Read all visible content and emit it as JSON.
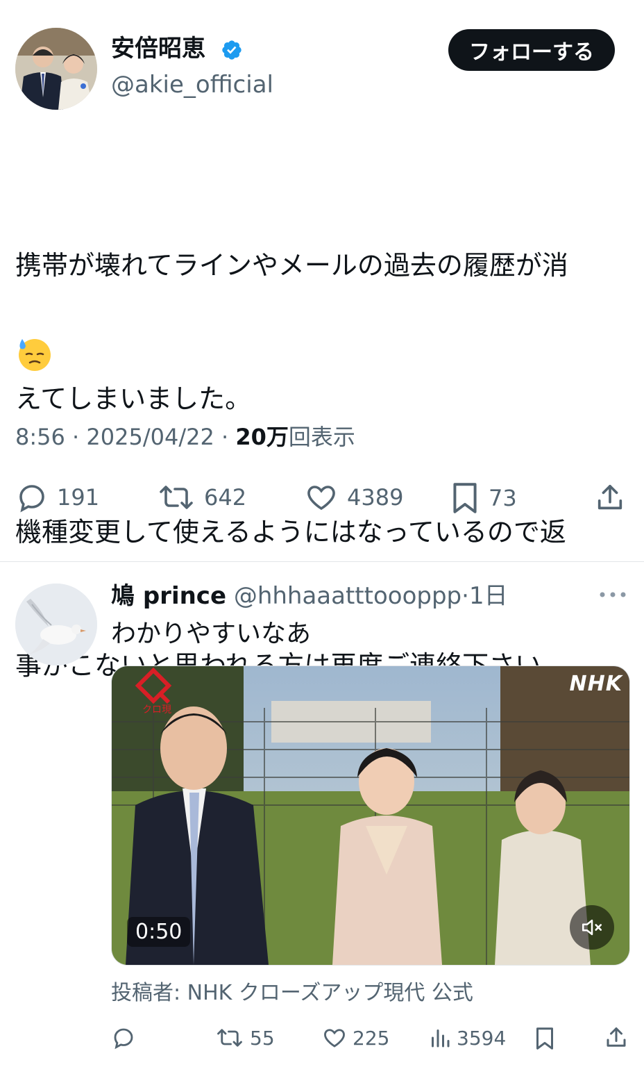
{
  "tweet": {
    "author_name": "安倍昭恵",
    "handle": "@akie_official",
    "follow_label": "フォローする",
    "text_lines": [
      "携帯が壊れてラインやメールの過去の履歴が消",
      "えてしまいました。",
      "機種変更して使えるようにはなっているので返",
      "事がこないと思われる方は再度ご連絡下さい"
    ],
    "emoji": "downcast-face-with-sweat",
    "time": "8:56",
    "date": "2025/04/22",
    "views_count": "20万",
    "views_label": "回表示",
    "separator": " · ",
    "stats": {
      "replies": "191",
      "retweets": "642",
      "likes": "4389",
      "bookmarks": "73"
    }
  },
  "reply": {
    "author_name": "鳩 prince",
    "handle": "@hhhaaatttoooppp",
    "time": "1日",
    "separator": "·",
    "text": "わかりやすいなあ",
    "video": {
      "duration": "0:50",
      "watermark": "NHK",
      "logo_text": "クロ現"
    },
    "source": "投稿者: NHK クローズアップ現代 公式",
    "stats": {
      "retweets": "55",
      "likes": "225",
      "views": "3594"
    }
  },
  "colors": {
    "verified_blue": "#1d9bf0",
    "text_primary": "#0f1419",
    "text_secondary": "#536471",
    "button_dark": "#0f1419"
  }
}
